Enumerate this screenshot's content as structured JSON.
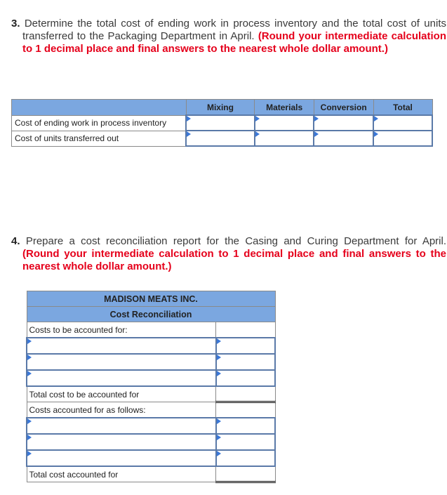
{
  "question3": {
    "number": "3.",
    "text": " Determine the total cost of ending work in process inventory and the total cost of units transferred to the Packaging Department in April. ",
    "instruction": "(Round your intermediate calculation to 1 decimal place and final answers to the nearest whole dollar amount.)"
  },
  "table1": {
    "headers": [
      "",
      "Mixing",
      "Materials",
      "Conversion",
      "Total"
    ],
    "rows": [
      {
        "label": "Cost of ending work in process inventory",
        "values": [
          "",
          "",
          "",
          ""
        ]
      },
      {
        "label": "Cost of units transferred out",
        "values": [
          "",
          "",
          "",
          ""
        ]
      }
    ]
  },
  "question4": {
    "number": "4.",
    "text": " Prepare a cost reconciliation report for the Casing and Curing Department for April. ",
    "instruction": "(Round your intermediate calculation to 1 decimal place and final answers to the nearest whole dollar amount.)"
  },
  "table2": {
    "company": "MADISON MEATS INC.",
    "title": "Cost Reconciliation",
    "section1_label": "Costs to be accounted for:",
    "section1_rows": [
      {
        "label": "",
        "value": ""
      },
      {
        "label": "",
        "value": ""
      },
      {
        "label": "",
        "value": ""
      }
    ],
    "total1_label": "Total cost to be accounted for",
    "total1_value": "",
    "section2_label": "Costs accounted for as follows:",
    "section2_rows": [
      {
        "label": "",
        "value": ""
      },
      {
        "label": "",
        "value": ""
      },
      {
        "label": "",
        "value": ""
      }
    ],
    "total2_label": "Total cost accounted for",
    "total2_value": ""
  },
  "colors": {
    "header_bg": "#7ba7e0",
    "instruction_red": "#e5001b",
    "input_border": "#5a79a8",
    "input_marker": "#3b78d8"
  }
}
